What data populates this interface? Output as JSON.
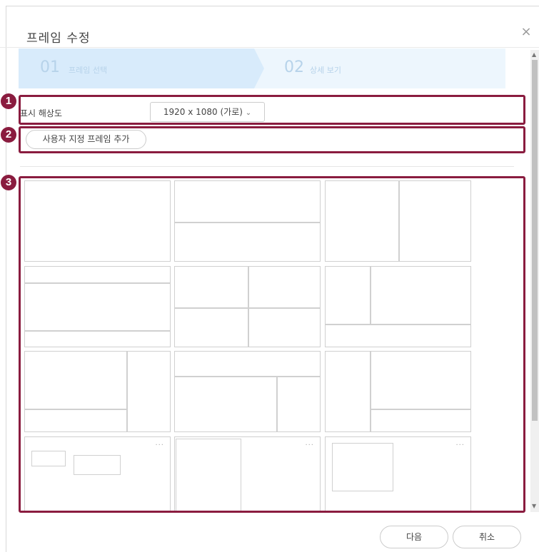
{
  "dialog": {
    "title": "프레임 수정",
    "close_symbol": "×"
  },
  "steps": [
    {
      "number": "01",
      "label": "프레임 선택"
    },
    {
      "number": "02",
      "label": "상세 보기"
    }
  ],
  "resolution": {
    "label": "표시 해상도",
    "selected": "1920 x 1080 (가로)",
    "caret": "⌄"
  },
  "custom_frame_button": "사용자 지정 프레임 추가",
  "callouts": [
    "1",
    "2",
    "3"
  ],
  "more_symbol": "···",
  "footer": {
    "next_label": "다음",
    "cancel_label": "취소"
  },
  "colors": {
    "highlight": "#8a1c3f",
    "step_active": "#d8ebfb",
    "step_inactive": "#edf6fd"
  }
}
